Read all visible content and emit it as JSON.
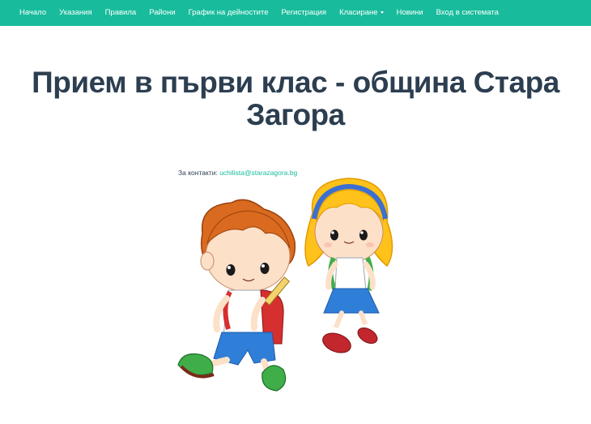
{
  "nav": {
    "items": [
      {
        "label": "Начало"
      },
      {
        "label": "Указания"
      },
      {
        "label": "Правила"
      },
      {
        "label": "Райони"
      },
      {
        "label": "График на дейностите"
      },
      {
        "label": "Регистрация"
      },
      {
        "label": "Класиране"
      },
      {
        "label": "Новини"
      },
      {
        "label": "Вход в системата"
      }
    ]
  },
  "main": {
    "title": "Прием в първи клас - община Стара Загора",
    "contact_label": "За контакти:",
    "contact_email": "uchilista@starazagora.bg"
  },
  "colors": {
    "brand": "#18bc9c",
    "heading": "#2c3e50"
  },
  "icons": {
    "dropdown": "caret-down-icon"
  }
}
